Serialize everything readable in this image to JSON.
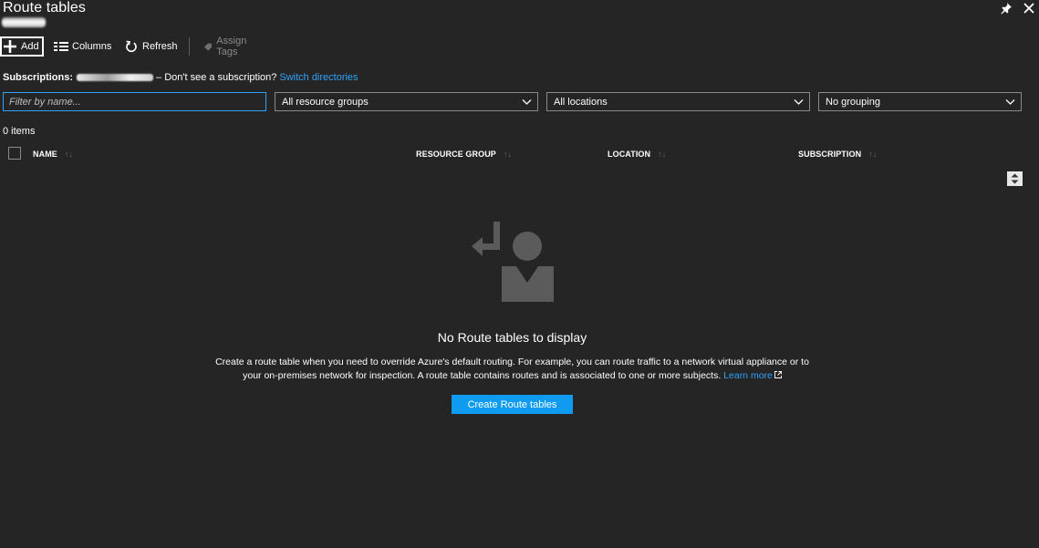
{
  "blade": {
    "title": "Route tables"
  },
  "toolbar": {
    "add_label": "Add",
    "columns_label": "Columns",
    "refresh_label": "Refresh",
    "assign_tags_label": "Assign Tags"
  },
  "subscriptions": {
    "label": "Subscriptions:",
    "hint": "– Don't see a subscription?",
    "switch_link": "Switch directories"
  },
  "filters": {
    "name_placeholder": "Filter by name...",
    "resource_group": "All resource groups",
    "location": "All locations",
    "grouping": "No grouping"
  },
  "list": {
    "count": "0 items",
    "columns": [
      "NAME",
      "RESOURCE GROUP",
      "LOCATION",
      "SUBSCRIPTION"
    ]
  },
  "empty_state": {
    "title": "No Route tables to display",
    "description": "Create a route table when you need to override Azure's default routing. For example, you can route traffic to a network virtual appliance or to your on-premises network for inspection. A route table contains routes and is associated to one or more subjects.",
    "learn_more": "Learn more",
    "create_button": "Create Route tables"
  },
  "colors": {
    "background": "#252526",
    "accent": "#2ea2f8",
    "button": "#0e9bf0",
    "icon_gray": "#5b5b5b"
  }
}
